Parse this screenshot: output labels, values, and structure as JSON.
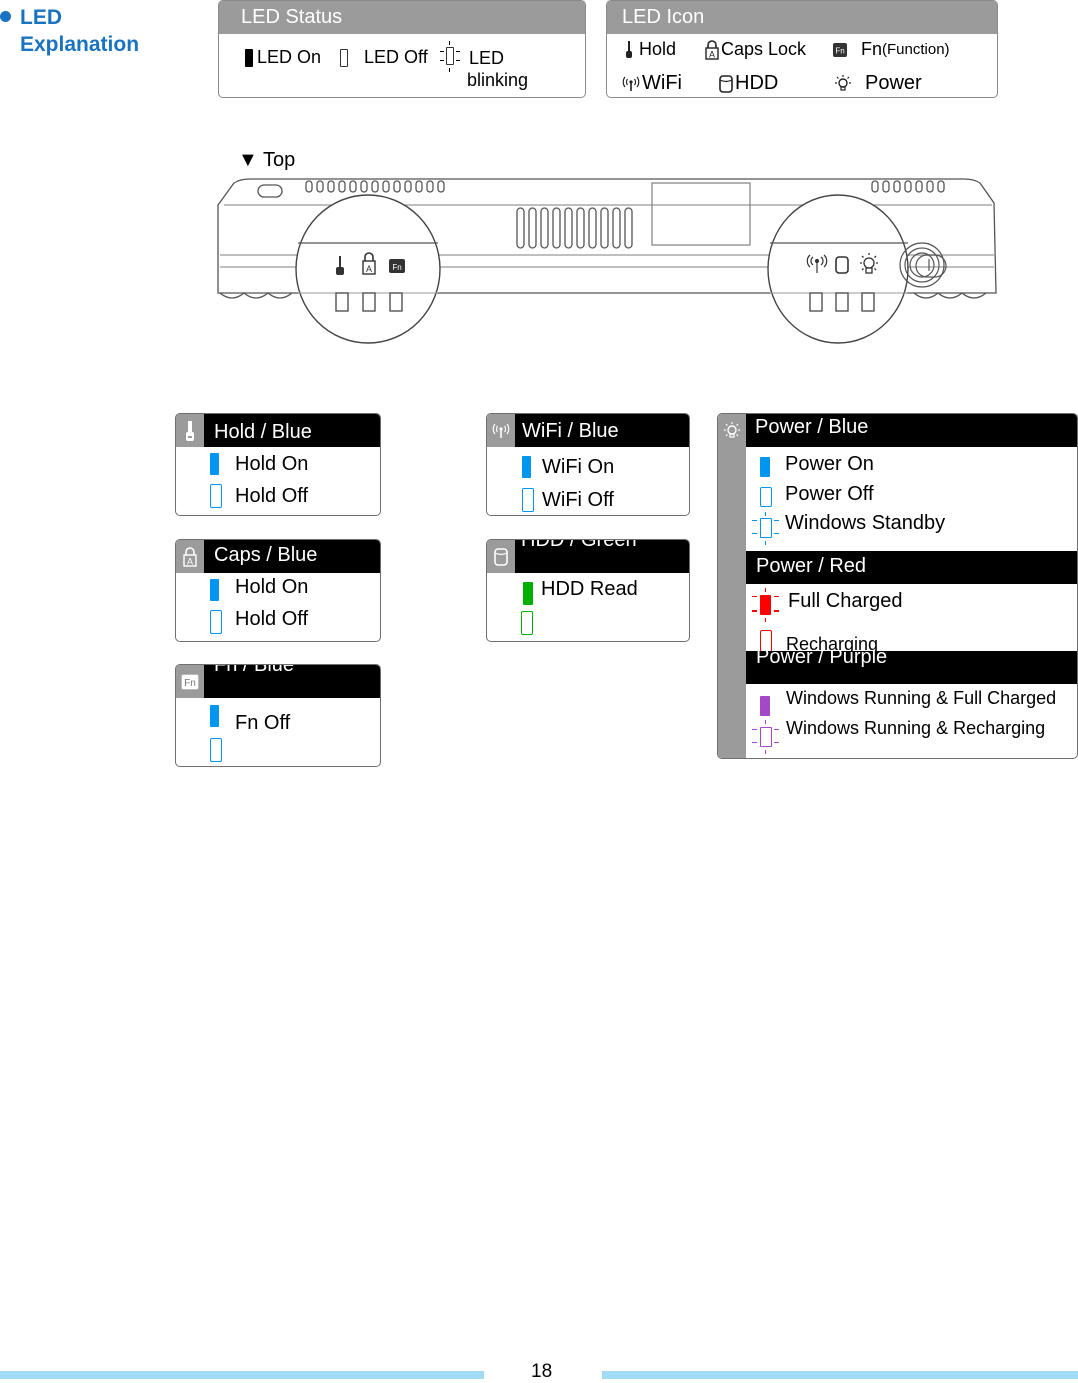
{
  "heading": {
    "line1": "LED",
    "line2": "Explanation",
    "color": "#1a73c1"
  },
  "led_status": {
    "title": "LED Status",
    "items": [
      {
        "state": "on",
        "label": "LED On"
      },
      {
        "state": "off",
        "label": "LED Off"
      },
      {
        "state": "blinking",
        "label_line1": "LED",
        "label_line2": "blinking"
      }
    ]
  },
  "led_icon": {
    "title": "LED Icon",
    "items": [
      {
        "icon": "hold-icon",
        "label": "Hold"
      },
      {
        "icon": "caps-lock-icon",
        "label": "Caps Lock"
      },
      {
        "icon": "fn-icon",
        "label": "Fn",
        "label_suffix": "(Function)"
      },
      {
        "icon": "wifi-icon",
        "label": "WiFi"
      },
      {
        "icon": "hdd-icon",
        "label": "HDD"
      },
      {
        "icon": "power-icon",
        "label": "Power"
      }
    ]
  },
  "device_view": {
    "label": "▼ Top",
    "left_indicators": [
      "hold-icon",
      "caps-lock-icon",
      "fn-icon"
    ],
    "right_indicators": [
      "wifi-icon",
      "hdd-icon",
      "power-icon"
    ]
  },
  "colors": {
    "blue": "#0096f0",
    "green": "#00b000",
    "red": "#ff0000",
    "purple": "#a349c8",
    "sidebar_gray": "#9b9b9b"
  },
  "cards": {
    "hold": {
      "title": "Hold / Blue",
      "rows": [
        {
          "state": "on",
          "label": "Hold On"
        },
        {
          "state": "off",
          "label": "Hold Off"
        }
      ]
    },
    "caps": {
      "title": "Caps / Blue",
      "rows": [
        {
          "state": "on",
          "label": "Hold On"
        },
        {
          "state": "off",
          "label": "Hold Off"
        }
      ]
    },
    "fn": {
      "title": "Fn / Blue",
      "hidden_label": "Fn Off",
      "rows": [
        {
          "state": "on",
          "label": "Fn Off"
        },
        {
          "state": "off",
          "label": ""
        }
      ]
    },
    "wifi": {
      "title": "WiFi / Blue",
      "rows": [
        {
          "state": "on",
          "label": "WiFi On"
        },
        {
          "state": "off",
          "label": "WiFi Off"
        }
      ]
    },
    "hdd": {
      "title": "HDD / Green",
      "rows": [
        {
          "state": "on",
          "label": "HDD Read"
        },
        {
          "state": "off",
          "label": ""
        }
      ]
    },
    "power": {
      "sections": [
        {
          "title": "Power / Blue",
          "rows": [
            {
              "state": "on",
              "label": "Power On"
            },
            {
              "state": "off",
              "label": "Power Off"
            },
            {
              "state": "blinking",
              "label": "Windows Standby"
            }
          ]
        },
        {
          "title": "Power / Red",
          "rows": [
            {
              "state": "blinking-on",
              "label": "Full Charged"
            },
            {
              "state": "off",
              "label": "Recharging"
            }
          ]
        },
        {
          "title": "Power / Purple",
          "rows": [
            {
              "state": "on",
              "label": "Windows Running & Full Charged"
            },
            {
              "state": "blinking",
              "label": "Windows Running & Recharging"
            }
          ]
        }
      ]
    }
  },
  "footer": {
    "page_number": "18"
  }
}
